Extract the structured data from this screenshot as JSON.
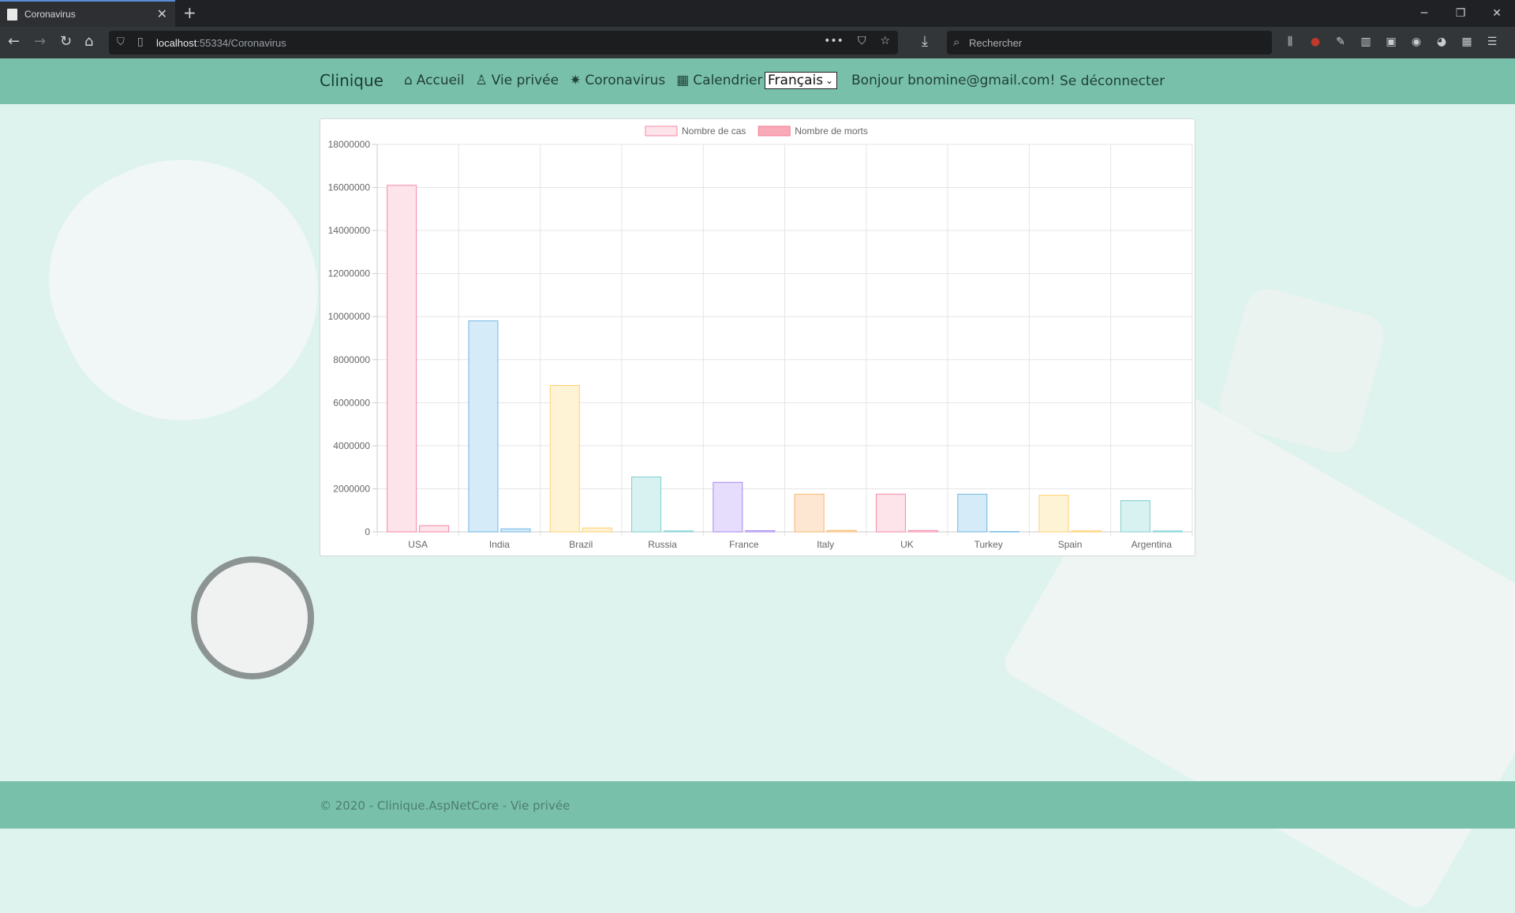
{
  "browser": {
    "tab_title": "Coronavirus",
    "url_host": "localhost",
    "url_rest": ":55334/Coronavirus",
    "search_placeholder": "Rechercher"
  },
  "header": {
    "brand": "Clinique",
    "nav": [
      {
        "label": "Accueil",
        "icon": "home-icon"
      },
      {
        "label": "Vie privée",
        "icon": "user-icon"
      },
      {
        "label": "Coronavirus",
        "icon": "virus-icon"
      },
      {
        "label": "Calendrier",
        "icon": "calendar-icon"
      }
    ],
    "language": "Français",
    "greeting": "Bonjour bnomine@gmail.com!",
    "logout": "Se déconnecter"
  },
  "footer": {
    "text": "© 2020 - Clinique.AspNetCore - Vie privée"
  },
  "chart_data": {
    "type": "bar",
    "categories": [
      "USA",
      "India",
      "Brazil",
      "Russia",
      "France",
      "Italy",
      "UK",
      "Turkey",
      "Spain",
      "Argentina"
    ],
    "series": [
      {
        "name": "Nombre de cas",
        "values": [
          16100000,
          9800000,
          6800000,
          2550000,
          2300000,
          1750000,
          1750000,
          1750000,
          1700000,
          1450000
        ]
      },
      {
        "name": "Nombre de morts",
        "values": [
          290000,
          140000,
          180000,
          45000,
          55000,
          62000,
          62000,
          16000,
          47000,
          40000
        ]
      }
    ],
    "ylim": [
      0,
      18000000
    ],
    "yticks": [
      "0",
      "2000000",
      "4000000",
      "6000000",
      "8000000",
      "10000000",
      "12000000",
      "14000000",
      "16000000",
      "18000000"
    ],
    "colors": {
      "fill": [
        "#fde3ea",
        "#d6ebf8",
        "#fff3d6",
        "#d8f1f1",
        "#e6dcfb",
        "#fde7d3",
        "#fde3ea",
        "#d6ebf8",
        "#fff3d6",
        "#d8f1f1"
      ],
      "border": [
        "#f58aa6",
        "#6fb6e6",
        "#ffcf6b",
        "#7fd0d0",
        "#a68af0",
        "#f9b46a",
        "#f58aa6",
        "#6fb6e6",
        "#ffcf6b",
        "#7fd0d0"
      ],
      "legend_cases": "#fde3ea",
      "legend_deaths": "#f9aab9"
    },
    "grid": true,
    "legend_position": "top"
  }
}
